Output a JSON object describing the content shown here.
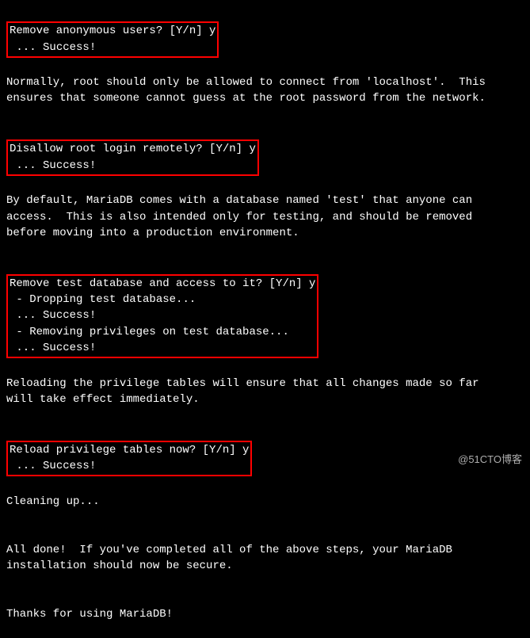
{
  "boxes": {
    "remove_anon": {
      "line1": "Remove anonymous users? [Y/n] y",
      "line2": " ... Success!"
    },
    "disallow_root": {
      "line1": "Disallow root login remotely? [Y/n] y",
      "line2": " ... Success!"
    },
    "remove_testdb": {
      "line1": "Remove test database and access to it? [Y/n] y",
      "line2": " - Dropping test database...",
      "line3": " ... Success!",
      "line4": " - Removing privileges on test database...",
      "line5": " ... Success!"
    },
    "reload_priv": {
      "line1": "Reload privilege tables now? [Y/n] y",
      "line2": " ... Success!"
    }
  },
  "paragraphs": {
    "normally_root": "Normally, root should only be allowed to connect from 'localhost'.  This\nensures that someone cannot guess at the root password from the network.",
    "by_default": "By default, MariaDB comes with a database named 'test' that anyone can\naccess.  This is also intended only for testing, and should be removed\nbefore moving into a production environment.",
    "reloading": "Reloading the privilege tables will ensure that all changes made so far\nwill take effect immediately.",
    "cleaning": "Cleaning up...",
    "all_done": "All done!  If you've completed all of the above steps, your MariaDB\ninstallation should now be secure.",
    "thanks": "Thanks for using MariaDB!"
  },
  "watermark": "@51CTO博客"
}
